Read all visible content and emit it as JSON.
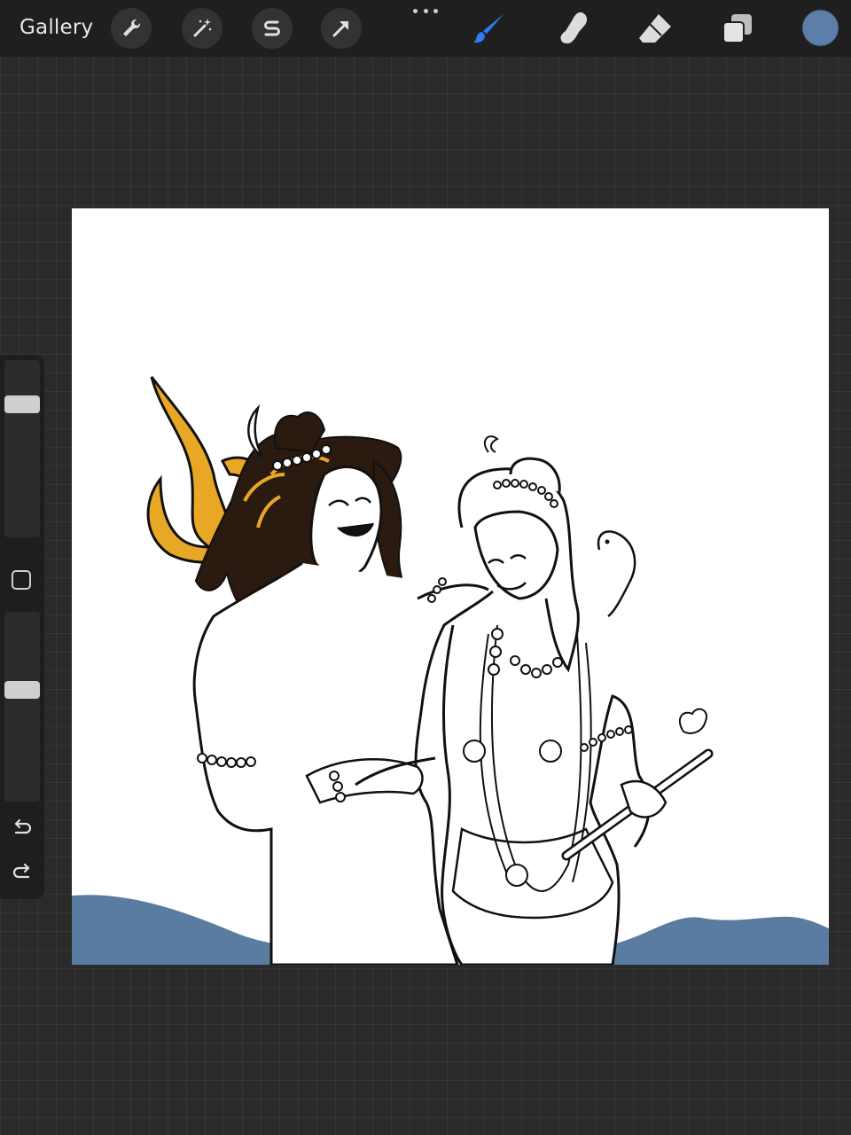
{
  "topbar": {
    "gallery_label": "Gallery",
    "left_tools": [
      "wrench-icon",
      "magic-wand-icon",
      "selection-s-icon",
      "transform-arrow-icon"
    ],
    "right_tools": [
      "brush-icon",
      "smudge-icon",
      "eraser-icon",
      "layers-icon"
    ],
    "active_tool": "brush",
    "current_color": "#5b7fa8",
    "accent_color": "#2f7cf6"
  },
  "sidebar": {
    "brush_size_level": 0.78,
    "opacity_level": 0.6,
    "icons": [
      "modify-square-icon",
      "undo-icon",
      "redo-icon"
    ]
  },
  "canvas": {
    "background": "#ffffff",
    "landscape_color": "#5a7ca0",
    "gold_color": "#e8a826",
    "hair_color": "#2a1a10"
  }
}
